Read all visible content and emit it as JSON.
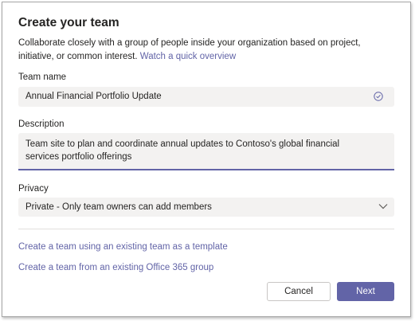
{
  "dialog": {
    "title": "Create your team",
    "description": "Collaborate closely with a group of people inside your organization based on project, initiative, or common interest.",
    "overview_link": "Watch a quick overview"
  },
  "team_name": {
    "label": "Team name",
    "value": "Annual Financial Portfolio Update",
    "status_icon": "check-circle-icon"
  },
  "description_field": {
    "label": "Description",
    "value": "Team site to plan and coordinate annual updates to Contoso's global financial services portfolio offerings"
  },
  "privacy": {
    "label": "Privacy",
    "selected": "Private - Only team owners can add members",
    "icon": "chevron-down-icon"
  },
  "alternatives": {
    "template_link": "Create a team using an existing team as a template",
    "group_link": "Create a team from an existing Office 365 group"
  },
  "buttons": {
    "cancel": "Cancel",
    "next": "Next"
  },
  "colors": {
    "accent": "#6264a7",
    "field_background": "#f3f2f1",
    "text": "#252423"
  }
}
